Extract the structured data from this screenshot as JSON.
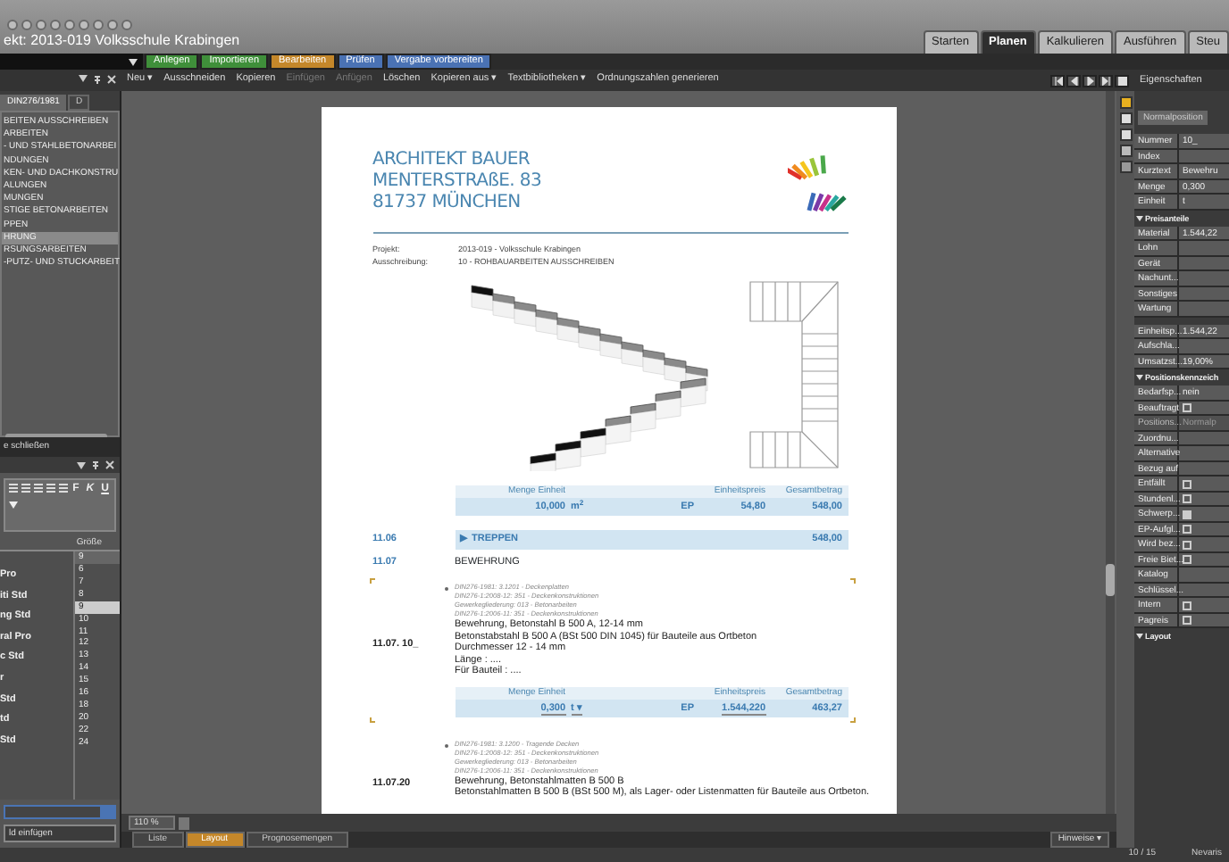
{
  "window": {
    "title": "ekt: 2013-019 Volksschule Krabingen"
  },
  "ribbon_tabs": [
    {
      "label": "Starten",
      "selected": false
    },
    {
      "label": "Planen",
      "selected": true
    },
    {
      "label": "Kalkulieren",
      "selected": false
    },
    {
      "label": "Ausführen",
      "selected": false
    },
    {
      "label": "Steu",
      "selected": false
    }
  ],
  "phase_buttons": [
    {
      "label": "Anlegen",
      "color": "#3f8f3a"
    },
    {
      "label": "Importieren",
      "color": "#3f8f3a"
    },
    {
      "label": "Bearbeiten",
      "color": "#c4872a"
    },
    {
      "label": "Prüfen",
      "color": "#4a72b4"
    },
    {
      "label": "Vergabe vorbereiten",
      "color": "#4a72b4"
    }
  ],
  "toolbar": [
    {
      "label": "Neu ▾",
      "disabled": false
    },
    {
      "label": "Ausschneiden",
      "disabled": false
    },
    {
      "label": "Kopieren",
      "disabled": false
    },
    {
      "label": "Einfügen",
      "disabled": true
    },
    {
      "label": "Anfügen",
      "disabled": true
    },
    {
      "label": "Löschen",
      "disabled": false
    },
    {
      "label": "Kopieren aus ▾",
      "disabled": false
    },
    {
      "label": "Textbibliotheken ▾",
      "disabled": false
    },
    {
      "label": "Ordnungszahlen generieren",
      "disabled": false
    }
  ],
  "left_panel": {
    "tabs": [
      {
        "label": "DIN276/1981",
        "selected": true
      },
      {
        "label": "D",
        "selected": false
      }
    ],
    "tree": [
      {
        "label": "BEITEN AUSSCHREIBEN",
        "selected": false
      },
      {
        "label": "ARBEITEN",
        "selected": false
      },
      {
        "label": "- UND STAHLBETONARBEI",
        "selected": false
      },
      {
        "label": "NDUNGEN",
        "selected": false
      },
      {
        "label": "KEN- UND DACHKONSTRU",
        "selected": false
      },
      {
        "label": "ALUNGEN",
        "selected": false
      },
      {
        "label": "MUNGEN",
        "selected": false
      },
      {
        "label": "STIGE BETONARBEITEN",
        "selected": false
      },
      {
        "label": "PPEN",
        "selected": false
      },
      {
        "label": "HRUNG",
        "selected": true
      },
      {
        "label": "RSUNGSARBEITEN",
        "selected": false
      },
      {
        "label": "-PUTZ- UND STUCKARBEIT",
        "selected": false
      }
    ],
    "close_label": "e schließen",
    "format_buttons": [
      "F",
      "K",
      "U"
    ],
    "size_header": "Größe",
    "size_value": "9",
    "fonts": [
      "Pro",
      "iti Std",
      "ng Std",
      "ral Pro",
      "c Std",
      "r",
      "Std",
      "td",
      "Std"
    ],
    "sizes": [
      {
        "label": "6",
        "selected": false
      },
      {
        "label": "7",
        "selected": false
      },
      {
        "label": "8",
        "selected": false
      },
      {
        "label": "9",
        "selected": true
      },
      {
        "label": "10",
        "selected": false
      },
      {
        "label": "11",
        "selected": false
      },
      {
        "label": "12",
        "selected": false
      },
      {
        "label": "13",
        "selected": false
      },
      {
        "label": "14",
        "selected": false
      },
      {
        "label": "15",
        "selected": false
      },
      {
        "label": "16",
        "selected": false
      },
      {
        "label": "18",
        "selected": false
      },
      {
        "label": "20",
        "selected": false
      },
      {
        "label": "22",
        "selected": false
      },
      {
        "label": "24",
        "selected": false
      }
    ],
    "insert_button": "ld einfügen"
  },
  "document": {
    "address": [
      "ARCHITEKT BAUER",
      "MENTERSTRAßE. 83",
      "81737 MÜNCHEN"
    ],
    "meta": [
      {
        "label": "Projekt:",
        "value": "2013-019 - Volksschule Krabingen"
      },
      {
        "label": "Ausschreibung:",
        "value": "10 - ROHBAUARBEITEN AUSSCHREIBEN"
      }
    ],
    "blocks": [
      {
        "kind": "qty",
        "headers": [
          "Menge Einheit",
          "Einheitspreis",
          "Gesamtbetrag"
        ],
        "qty": "10,000",
        "unit": "m$^{2}$",
        "ep": "EP",
        "price": "54,80",
        "total": "548,00"
      },
      {
        "kind": "title",
        "number": "11.06",
        "label": "▶ TREPPEN",
        "total": "548,00"
      },
      {
        "kind": "heading",
        "number": "11.07",
        "label": "BEWEHRUNG"
      },
      {
        "kind": "position",
        "number": "11.07. 10_",
        "refs": [
          "DIN276-1981: 3.1201 - Deckenplatten",
          "DIN276-1:2008-12: 351 - Deckenkonstruktionen",
          "Gewerkegliederung: 013 - Betonarbeiten",
          "DIN276-1:2006-11: 351 - Deckenkonstruktionen"
        ],
        "lines": [
          "Bewehrung, Betonstahl B 500 A, 12-14 mm",
          "Betonstabstahl B 500 A (BSt 500 DIN 1045) für Bauteile aus Ortbeton",
          "Durchmesser   12 - 14 mm",
          "Länge : ....",
          "Für Bauteil : ...."
        ]
      },
      {
        "kind": "qty",
        "headers": [
          "Menge Einheit",
          "Einheitspreis",
          "Gesamtbetrag"
        ],
        "qty": "0,300",
        "unit": "t ▾",
        "ep": "EP",
        "price": "1.544,220",
        "total": "463,27"
      },
      {
        "kind": "position",
        "number": "11.07.20",
        "refs": [
          "DIN276-1981: 3.1200 - Tragende Decken",
          "DIN276-1:2008-12: 351 - Deckenkonstruktionen",
          "Gewerkegliederung: 013 - Betonarbeiten",
          "DIN276-1:2006-11: 351 - Deckenkonstruktionen"
        ],
        "lines": [
          "Bewehrung, Betonstahlmatten B 500 B",
          "Betonstahlmatten B 500 B (BSt 500 M), als Lager- oder Listenmatten für Bauteile aus Ortbeton."
        ]
      }
    ]
  },
  "properties": {
    "title": "Eigenschaften",
    "tab": "Normalposition",
    "groups": [
      {
        "rows": [
          {
            "kind": "field",
            "label": "Nummer",
            "value": "10_",
            "disabled": false
          },
          {
            "kind": "field",
            "label": "Index",
            "value": "",
            "disabled": false
          },
          {
            "kind": "field",
            "label": "Kurztext",
            "value": "Bewehru",
            "disabled": false
          },
          {
            "kind": "field",
            "label": "Menge",
            "value": "0,300",
            "disabled": false
          },
          {
            "kind": "field",
            "label": "Einheit",
            "value": "t",
            "disabled": false
          }
        ]
      },
      {
        "title": "Preisanteile",
        "rows": [
          {
            "kind": "field",
            "label": "Material",
            "value": "1.544,22",
            "disabled": false
          },
          {
            "kind": "field",
            "label": "Lohn",
            "value": "",
            "disabled": false
          },
          {
            "kind": "field",
            "label": "Gerät",
            "value": "",
            "disabled": false
          },
          {
            "kind": "field",
            "label": "Nachunt...",
            "value": "",
            "disabled": false
          },
          {
            "kind": "field",
            "label": "Sonstiges",
            "value": "",
            "disabled": false
          },
          {
            "kind": "field",
            "label": "Wartung",
            "value": "",
            "disabled": false
          }
        ]
      },
      {
        "rows": [
          {
            "kind": "field",
            "label": "Einheitsp...",
            "value": "1.544,22",
            "disabled": false
          },
          {
            "kind": "field",
            "label": "Aufschla...",
            "value": "",
            "disabled": false
          },
          {
            "kind": "field",
            "label": "Umsatzst...",
            "value": "19,00%",
            "disabled": false
          }
        ]
      },
      {
        "title": "Positionskennzeich",
        "rows": [
          {
            "kind": "field",
            "label": "Bedarfsp...",
            "value": "nein",
            "disabled": false
          },
          {
            "kind": "check",
            "label": "Beauftragt",
            "checked": false
          },
          {
            "kind": "field",
            "label": "Positions...",
            "value": "Normalp",
            "disabled": true
          },
          {
            "kind": "field",
            "label": "Zuordnu...",
            "value": "",
            "disabled": false
          },
          {
            "kind": "field",
            "label": "Alternative",
            "value": "",
            "disabled": false
          },
          {
            "kind": "field",
            "label": "Bezug auf",
            "value": "",
            "disabled": false
          },
          {
            "kind": "check",
            "label": "Entfällt",
            "checked": false
          },
          {
            "kind": "check",
            "label": "Stundenl...",
            "checked": false
          },
          {
            "kind": "check",
            "label": "Schwerp...",
            "checked": true
          },
          {
            "kind": "check",
            "label": "EP-Aufgl...",
            "checked": false
          },
          {
            "kind": "check",
            "label": "Wird bez...",
            "checked": false
          },
          {
            "kind": "check",
            "label": "Freie Biet...",
            "checked": false
          },
          {
            "kind": "field",
            "label": "Katalog",
            "value": "",
            "disabled": false
          },
          {
            "kind": "field",
            "label": "Schlüssel...",
            "value": "",
            "disabled": false
          },
          {
            "kind": "check",
            "label": "Intern",
            "checked": false
          },
          {
            "kind": "check",
            "label": "Pagreis",
            "checked": false
          }
        ]
      },
      {
        "title": "Layout"
      }
    ]
  },
  "zoom": "110 %",
  "view_tabs": [
    {
      "label": "Liste",
      "selected": false
    },
    {
      "label": "Layout",
      "selected": true
    },
    {
      "label": "Prognosemengen",
      "selected": false
    }
  ],
  "hints": "Hinweise ▾",
  "status": {
    "page": "10 / 15",
    "brand": "Nevaris"
  }
}
